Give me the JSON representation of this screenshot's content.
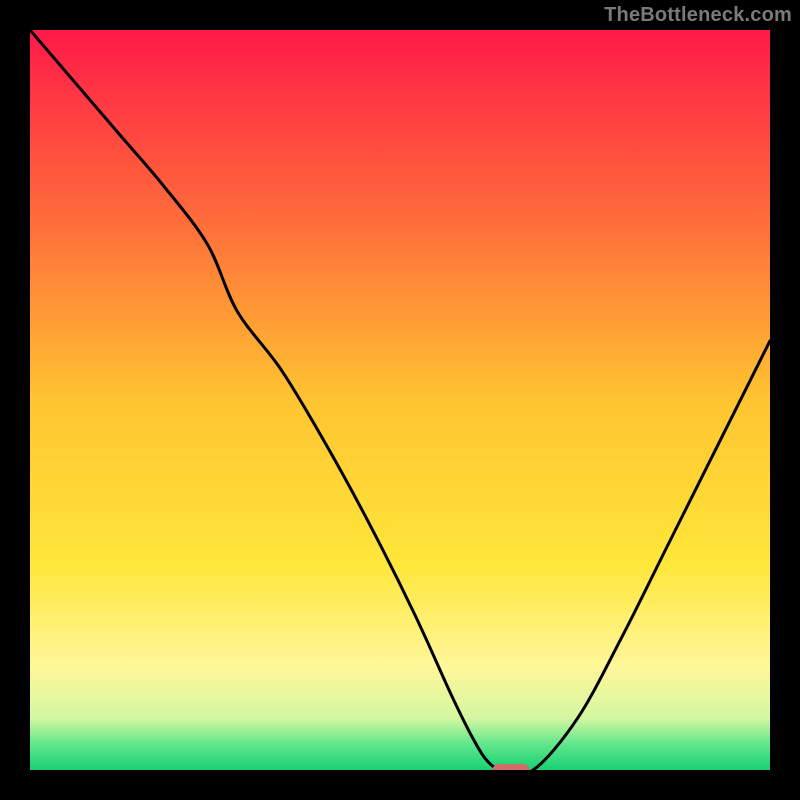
{
  "watermark": "TheBottleneck.com",
  "chart_data": {
    "type": "line",
    "title": "",
    "xlabel": "",
    "ylabel": "",
    "xlim": [
      0,
      100
    ],
    "ylim": [
      0,
      100
    ],
    "grid": false,
    "legend": false,
    "gradient_stops": [
      {
        "offset": 0.0,
        "color": "#ff1a49"
      },
      {
        "offset": 0.25,
        "color": "#ff6a3a"
      },
      {
        "offset": 0.5,
        "color": "#ffc431"
      },
      {
        "offset": 0.72,
        "color": "#ffe63a"
      },
      {
        "offset": 0.86,
        "color": "#fff79a"
      },
      {
        "offset": 0.93,
        "color": "#d4f7a0"
      },
      {
        "offset": 0.965,
        "color": "#61e68c"
      },
      {
        "offset": 1.0,
        "color": "#18d074"
      }
    ],
    "series": [
      {
        "name": "bottleneck-curve",
        "color": "#000000",
        "x": [
          0,
          6,
          12,
          18,
          24,
          28,
          34,
          40,
          46,
          52,
          57,
          60,
          62,
          64,
          68,
          74,
          80,
          86,
          92,
          100
        ],
        "values": [
          100,
          93,
          86,
          79,
          71,
          62,
          54,
          44,
          33,
          21,
          10,
          4,
          1,
          0,
          0,
          7,
          18,
          30,
          42,
          58
        ]
      }
    ],
    "marker": {
      "name": "optimal-point",
      "x": 65,
      "y": 0,
      "color": "#d46a6a",
      "width": 5,
      "height": 1.6
    }
  }
}
